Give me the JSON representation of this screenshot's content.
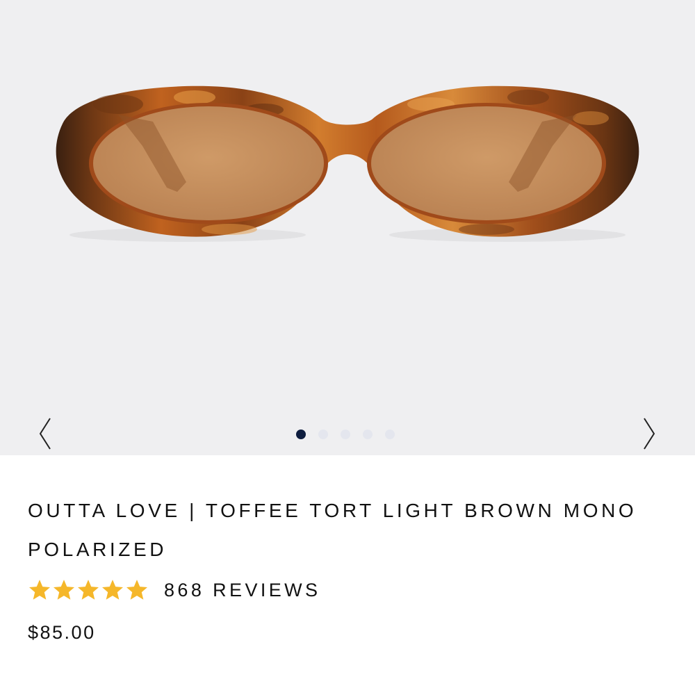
{
  "product": {
    "title": "OUTTA LOVE | TOFFEE TORT LIGHT BROWN MONO POLARIZED",
    "rating": 5,
    "rating_max": 5,
    "reviews_label": "868 REVIEWS",
    "price": "$85.00"
  },
  "gallery": {
    "slide_count": 5,
    "active_slide": 1,
    "prev_icon": "chevron-left-icon",
    "next_icon": "chevron-right-icon"
  },
  "colors": {
    "gallery_bg": "#efeff1",
    "dot_active": "#0e1d3f",
    "dot_inactive": "#e4e6ee",
    "star": "#f5b72a",
    "frame": "#a8501e",
    "lens": "#c99460"
  }
}
